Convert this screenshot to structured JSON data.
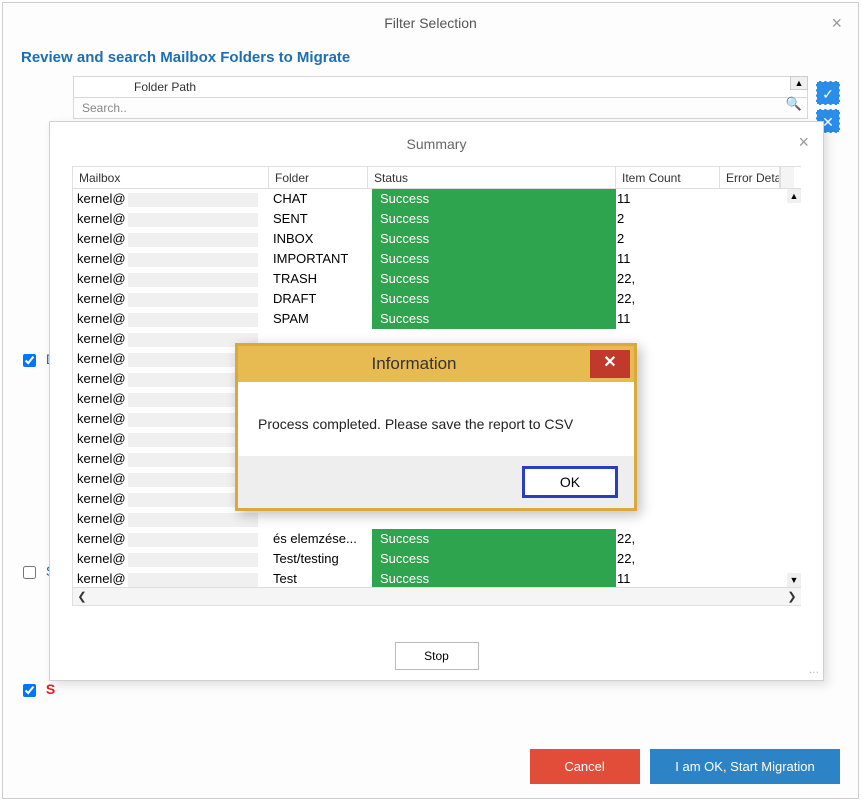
{
  "outer": {
    "title": "Filter Selection",
    "section_title": "Review and search Mailbox Folders to Migrate",
    "folder_path_label": "Folder Path",
    "search_placeholder": "Search..",
    "cancel": "Cancel",
    "start": "I am OK, Start Migration",
    "checkbox_d": "D",
    "checkbox_s": "S",
    "checkbox_skip": "S"
  },
  "summary": {
    "title": "Summary",
    "columns": {
      "mailbox": "Mailbox",
      "folder": "Folder",
      "status": "Status",
      "item_count": "Item Count",
      "error": "Error Details"
    },
    "rows": [
      {
        "mailprefix": "kernel@",
        "folder": "CHAT",
        "status": "Success",
        "count": "11"
      },
      {
        "mailprefix": "kernel@",
        "folder": "SENT",
        "status": "Success",
        "count": " 2"
      },
      {
        "mailprefix": "kernel@",
        "folder": "INBOX",
        "status": "Success",
        "count": " 2"
      },
      {
        "mailprefix": "kernel@",
        "folder": "IMPORTANT",
        "status": "Success",
        "count": "11"
      },
      {
        "mailprefix": "kernel@",
        "folder": "TRASH",
        "status": "Success",
        "count": "22,"
      },
      {
        "mailprefix": "kernel@",
        "folder": "DRAFT",
        "status": "Success",
        "count": "22,"
      },
      {
        "mailprefix": "kernel@",
        "folder": "SPAM",
        "status": "Success",
        "count": "11"
      },
      {
        "mailprefix": "kernel@",
        "folder": "",
        "status": "",
        "count": ""
      },
      {
        "mailprefix": "kernel@",
        "folder": "",
        "status": "",
        "count": ""
      },
      {
        "mailprefix": "kernel@",
        "folder": "",
        "status": "",
        "count": ""
      },
      {
        "mailprefix": "kernel@",
        "folder": "",
        "status": "",
        "count": ""
      },
      {
        "mailprefix": "kernel@",
        "folder": "",
        "status": "",
        "count": ""
      },
      {
        "mailprefix": "kernel@",
        "folder": "",
        "status": "",
        "count": ""
      },
      {
        "mailprefix": "kernel@",
        "folder": "",
        "status": "",
        "count": ""
      },
      {
        "mailprefix": "kernel@",
        "folder": "",
        "status": "",
        "count": ""
      },
      {
        "mailprefix": "kernel@",
        "folder": "",
        "status": "",
        "count": ""
      },
      {
        "mailprefix": "kernel@",
        "folder": "",
        "status": "",
        "count": ""
      },
      {
        "mailprefix": "kernel@",
        "folder": "és elemzése...",
        "status": "Success",
        "count": "22,"
      },
      {
        "mailprefix": "kernel@",
        "folder": "Test/testing",
        "status": "Success",
        "count": "22,"
      },
      {
        "mailprefix": "kernel@",
        "folder": "Test",
        "status": "Success",
        "count": "11"
      }
    ],
    "stop": "Stop"
  },
  "info": {
    "title": "Information",
    "message": "Process completed. Please save the report to CSV",
    "ok": "OK"
  }
}
